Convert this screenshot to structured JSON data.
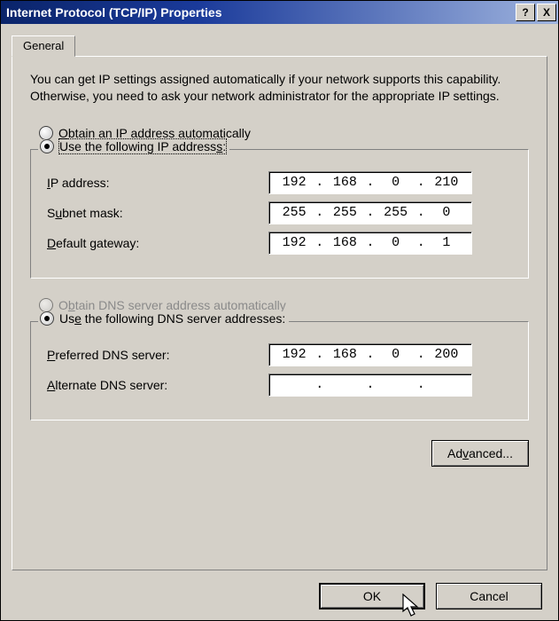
{
  "title": "Internet Protocol (TCP/IP) Properties",
  "title_buttons": {
    "help": "?",
    "close": "X"
  },
  "tab": {
    "general": "General"
  },
  "intro": "You can get IP settings assigned automatically if your network supports this capability. Otherwise, you need to ask your network administrator for the appropriate IP settings.",
  "ip": {
    "obtain_label_pre": "O",
    "obtain_label_rest": "btain an IP address automatically",
    "use_label_pre": "Use the following IP address",
    "use_label_accel": "s",
    "use_label_post": ":",
    "fields": {
      "ip_label_accel": "I",
      "ip_label_rest": "P address:",
      "subnet_label_pre": "S",
      "subnet_label_accel": "u",
      "subnet_label_rest": "bnet mask:",
      "gw_label_accel": "D",
      "gw_label_rest": "efault gateway:"
    },
    "values": {
      "ip": [
        "192",
        "168",
        "0",
        "210"
      ],
      "subnet": [
        "255",
        "255",
        "255",
        "0"
      ],
      "gateway": [
        "192",
        "168",
        "0",
        "1"
      ]
    }
  },
  "dns": {
    "obtain_label_pre": "O",
    "obtain_label_accel": "b",
    "obtain_label_rest": "tain DNS server address automatically",
    "use_label_pre": "Us",
    "use_label_accel": "e",
    "use_label_rest": " the following DNS server addresses:",
    "fields": {
      "p_label_accel": "P",
      "p_label_rest": "referred DNS server:",
      "a_label_accel": "A",
      "a_label_rest": "lternate DNS server:"
    },
    "values": {
      "preferred": [
        "192",
        "168",
        "0",
        "200"
      ],
      "alternate": [
        "",
        "",
        "",
        ""
      ]
    }
  },
  "buttons": {
    "advanced_pre": "Ad",
    "advanced_accel": "v",
    "advanced_rest": "anced...",
    "ok": "OK",
    "cancel": "Cancel"
  }
}
